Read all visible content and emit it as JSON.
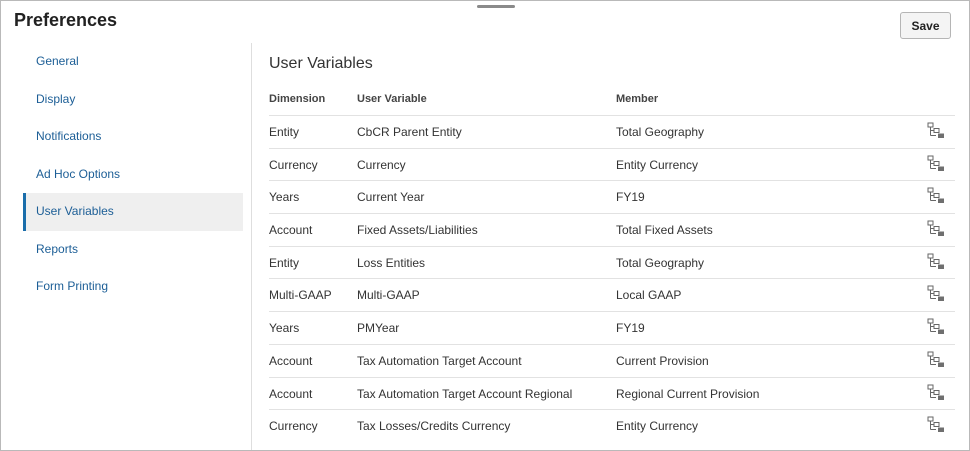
{
  "header": {
    "title": "Preferences",
    "save_label": "Save"
  },
  "sidebar": {
    "items": [
      {
        "label": "General"
      },
      {
        "label": "Display"
      },
      {
        "label": "Notifications"
      },
      {
        "label": "Ad Hoc Options"
      },
      {
        "label": "User Variables",
        "active": true
      },
      {
        "label": "Reports"
      },
      {
        "label": "Form Printing"
      }
    ]
  },
  "main": {
    "title": "User Variables",
    "columns": {
      "dimension": "Dimension",
      "user_variable": "User Variable",
      "member": "Member"
    },
    "member_selector_icon": "member-selector-icon",
    "rows": [
      {
        "dimension": "Entity",
        "user_variable": "CbCR Parent Entity",
        "member": "Total Geography"
      },
      {
        "dimension": "Currency",
        "user_variable": "Currency",
        "member": "Entity Currency"
      },
      {
        "dimension": "Years",
        "user_variable": "Current Year",
        "member": "FY19"
      },
      {
        "dimension": "Account",
        "user_variable": "Fixed Assets/Liabilities",
        "member": "Total Fixed Assets"
      },
      {
        "dimension": "Entity",
        "user_variable": "Loss Entities",
        "member": "Total Geography"
      },
      {
        "dimension": "Multi-GAAP",
        "user_variable": "Multi-GAAP",
        "member": "Local GAAP"
      },
      {
        "dimension": "Years",
        "user_variable": "PMYear",
        "member": "FY19"
      },
      {
        "dimension": "Account",
        "user_variable": "Tax Automation Target Account",
        "member": "Current Provision"
      },
      {
        "dimension": "Account",
        "user_variable": "Tax Automation Target Account Regional",
        "member": "Regional Current Provision"
      },
      {
        "dimension": "Currency",
        "user_variable": "Tax Losses/Credits Currency",
        "member": "Entity Currency"
      }
    ]
  },
  "colors": {
    "link": "#1c5e96",
    "active_bar": "#1a6daa",
    "active_bg": "#efefef"
  }
}
